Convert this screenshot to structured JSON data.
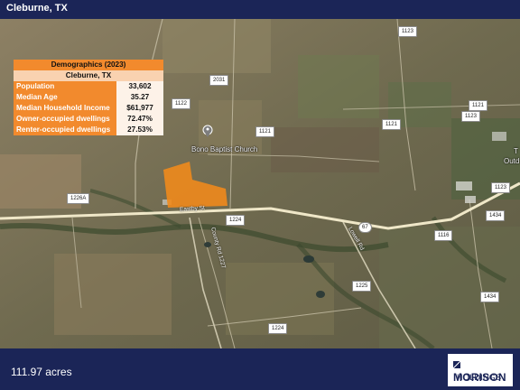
{
  "header": {
    "title": "Cleburne, TX"
  },
  "footer": {
    "acreage": "111.97 acres"
  },
  "logo": {
    "line1": "MORISON",
    "line2": "HOLDINGS"
  },
  "demographics": {
    "title": "Demographics (2023)",
    "location": "Cleburne, TX",
    "rows": [
      {
        "label": "Population",
        "value": "33,602"
      },
      {
        "label": "Median Age",
        "value": "35.27"
      },
      {
        "label": "Median Household Income",
        "value": "$61,977"
      },
      {
        "label": "Owner-occupied dwellings",
        "value": "72.47%"
      },
      {
        "label": "Renter-occupied dwellings",
        "value": "27.53%"
      }
    ]
  },
  "map": {
    "landmark": "Bono Baptist Church",
    "road_labels": [
      "Eastby St",
      "County Rd 1227",
      "Lowell Rd"
    ],
    "shields": [
      "1123",
      "2031",
      "1122",
      "1121",
      "1121",
      "1123",
      "1121",
      "1226A",
      "1224",
      "1123",
      "1434",
      "1116",
      "1225",
      "1434",
      "1224",
      "67"
    ],
    "edge_text": [
      "T",
      "Outd"
    ],
    "parcel_color": "#f08a1c",
    "pin_icon": "place-marker-icon"
  }
}
